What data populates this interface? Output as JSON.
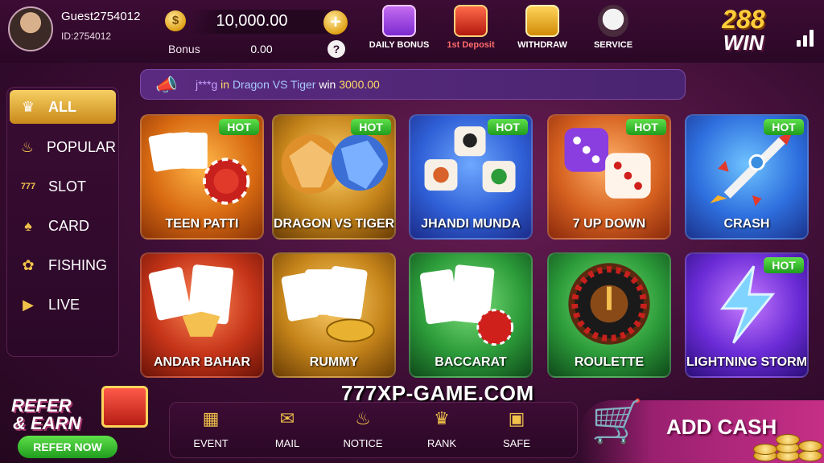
{
  "user": {
    "name": "Guest2754012",
    "id": "ID:2754012"
  },
  "wallet": {
    "coin_symbol": "$",
    "balance": "10,000.00",
    "plus": "+",
    "bonus_label": "Bonus",
    "bonus_value": "0.00",
    "help": "?"
  },
  "top_actions": [
    {
      "label": "DAILY BONUS",
      "icon": "gift-box-icon"
    },
    {
      "label": "1st Deposit",
      "icon": "gift-box-icon"
    },
    {
      "label": "WITHDRAW",
      "icon": "wallet-icon"
    },
    {
      "label": "SERVICE",
      "icon": "headset-icon"
    }
  ],
  "logo": {
    "line1": "288",
    "line2": "WIN"
  },
  "marquee": {
    "user": "j***g",
    "prefix": " in ",
    "game": "Dragon VS Tiger",
    "mid": " win ",
    "amount": "3000.00",
    "icon": "megaphone-icon"
  },
  "sidebar": {
    "items": [
      {
        "label": "ALL",
        "icon": "crown-icon",
        "active": true
      },
      {
        "label": "POPULAR",
        "icon": "fire-icon"
      },
      {
        "label": "SLOT",
        "icon": "slot-777-icon"
      },
      {
        "label": "CARD",
        "icon": "cards-icon"
      },
      {
        "label": "FISHING",
        "icon": "fish-icon"
      },
      {
        "label": "LIVE",
        "icon": "video-icon"
      }
    ]
  },
  "games": [
    {
      "label": "TEEN PATTI",
      "hot": "HOT",
      "color": "#d86a12"
    },
    {
      "label": "DRAGON VS TIGER",
      "hot": "HOT",
      "color": "#c5841a"
    },
    {
      "label": "JHANDI MUNDA",
      "hot": "HOT",
      "color": "#2f5fd6"
    },
    {
      "label": "7 UP DOWN",
      "hot": "HOT",
      "color": "#d5601f"
    },
    {
      "label": "CRASH",
      "hot": "HOT",
      "color": "#2e6fde"
    },
    {
      "label": "ANDAR BAHAR",
      "hot": "",
      "color": "#c53418"
    },
    {
      "label": "RUMMY",
      "hot": "",
      "color": "#c5841a"
    },
    {
      "label": "BACCARAT",
      "hot": "",
      "color": "#2c9c3a"
    },
    {
      "label": "ROULETTE",
      "hot": "",
      "color": "#2c9c3a"
    },
    {
      "label": "LIGHTNING STORM",
      "hot": "HOT",
      "color": "#6a2bd6"
    }
  ],
  "watermark": "777XP-GAME.COM",
  "refer": {
    "line1": "REFER",
    "line2": "& EARN",
    "button": "REFER NOW"
  },
  "bottom_nav": [
    {
      "label": "EVENT",
      "icon": "gift-icon"
    },
    {
      "label": "MAIL",
      "icon": "mail-icon"
    },
    {
      "label": "NOTICE",
      "icon": "bell-icon"
    },
    {
      "label": "RANK",
      "icon": "trophy-icon"
    },
    {
      "label": "SAFE",
      "icon": "safe-icon"
    }
  ],
  "add_cash": {
    "label": "ADD CASH",
    "icon": "cart-icon"
  }
}
